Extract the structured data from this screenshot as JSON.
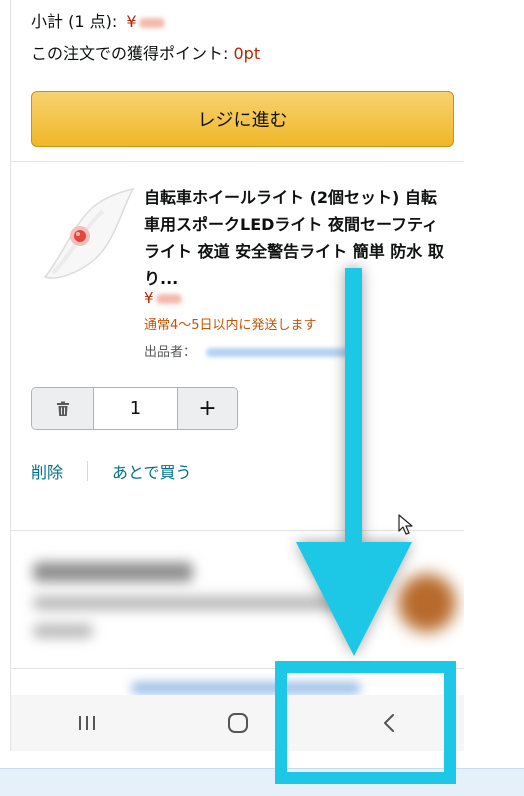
{
  "cart": {
    "subtotal_label": "小計 (1 点):",
    "subtotal_currency": "¥",
    "points_label": "この注文での獲得ポイント:",
    "points_value": "0pt",
    "checkout_label": "レジに進む"
  },
  "item": {
    "title": "自転車ホイールライト (2個セット) 自転車用スポークLEDライト 夜間セーフティライト 夜道 安全警告ライト 簡単 防水 取り...",
    "currency": "¥",
    "shipping": "通常4～5日以内に発送します",
    "seller_label": "出品者：",
    "quantity": "1",
    "plus": "+",
    "delete_label": "削除",
    "save_later_label": "あとで買う"
  },
  "icons": {
    "trash": "trash-icon",
    "recent_apps": "recent-apps-icon",
    "home": "home-icon",
    "back": "back-icon",
    "pointer": "mouse-pointer-icon",
    "arrow": "down-arrow-annotation"
  },
  "colors": {
    "accent_annotation": "#1cc8e6",
    "price_red": "#b12704",
    "link_teal": "#007185",
    "shipping_orange": "#c45500",
    "checkout_yellow": "#f0c14b"
  }
}
